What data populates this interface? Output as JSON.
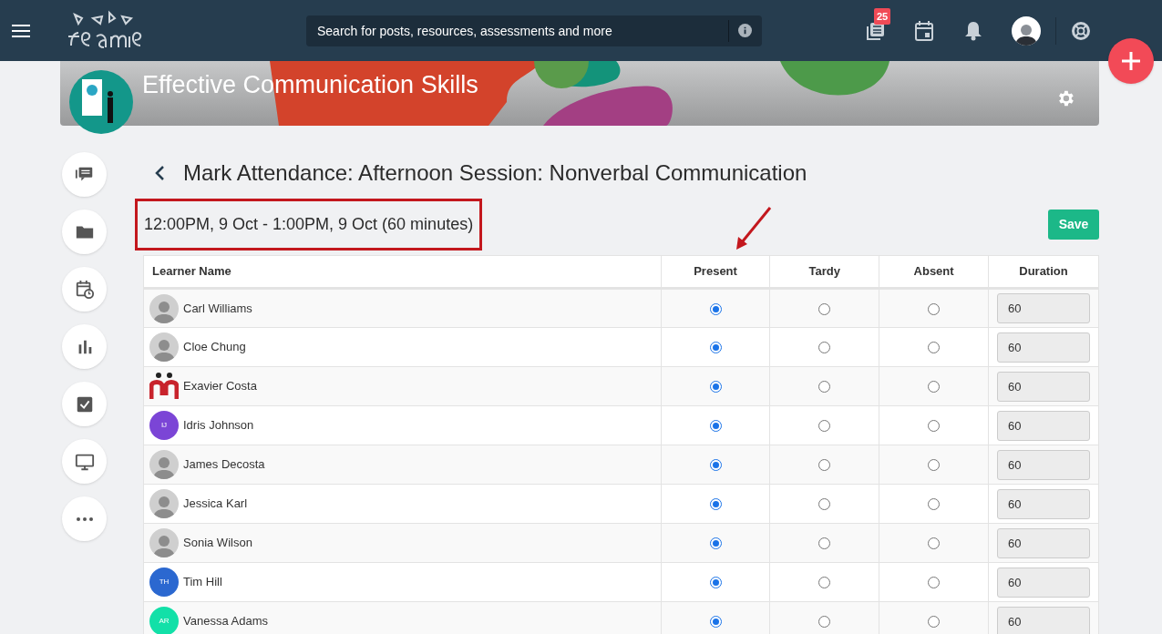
{
  "header": {
    "search": {
      "placeholder": "Search for posts, resources, assessments and more"
    },
    "badge": "25"
  },
  "course": {
    "title": "Effective Communication Skills"
  },
  "sidebar": {
    "items": [
      {
        "kind": "chat"
      },
      {
        "kind": "folder"
      },
      {
        "kind": "calendar"
      },
      {
        "kind": "chart"
      },
      {
        "kind": "check"
      },
      {
        "kind": "monitor"
      },
      {
        "kind": "more"
      }
    ]
  },
  "page": {
    "title": "Mark Attendance: Afternoon Session: Nonverbal Communication",
    "time": "12:00PM, 9 Oct - 1:00PM, 9 Oct (60 minutes)",
    "save": "Save"
  },
  "table": {
    "columns": [
      "Learner Name",
      "Present",
      "Tardy",
      "Absent",
      "Duration"
    ],
    "rows": [
      {
        "name": "Carl Williams",
        "avatar": {
          "kind": "photo"
        },
        "present": true,
        "tardy": false,
        "absent": false,
        "duration": "60"
      },
      {
        "name": "Cloe Chung",
        "avatar": {
          "kind": "photo"
        },
        "present": true,
        "tardy": false,
        "absent": false,
        "duration": "60"
      },
      {
        "name": "Exavier Costa",
        "avatar": {
          "kind": "logo"
        },
        "present": true,
        "tardy": false,
        "absent": false,
        "duration": "60"
      },
      {
        "name": "Idris Johnson",
        "avatar": {
          "kind": "initials",
          "text": "IJ",
          "color": "#7b45d6"
        },
        "present": true,
        "tardy": false,
        "absent": false,
        "duration": "60"
      },
      {
        "name": "James Decosta",
        "avatar": {
          "kind": "photo"
        },
        "present": true,
        "tardy": false,
        "absent": false,
        "duration": "60"
      },
      {
        "name": "Jessica Karl",
        "avatar": {
          "kind": "photo"
        },
        "present": true,
        "tardy": false,
        "absent": false,
        "duration": "60"
      },
      {
        "name": "Sonia Wilson",
        "avatar": {
          "kind": "photo"
        },
        "present": true,
        "tardy": false,
        "absent": false,
        "duration": "60"
      },
      {
        "name": "Tim Hill",
        "avatar": {
          "kind": "initials",
          "text": "TH",
          "color": "#2b68d0"
        },
        "present": true,
        "tardy": false,
        "absent": false,
        "duration": "60"
      },
      {
        "name": "Vanessa Adams",
        "avatar": {
          "kind": "initials",
          "text": "AR",
          "color": "#12e0a8"
        },
        "present": true,
        "tardy": false,
        "absent": false,
        "duration": "60"
      }
    ]
  }
}
